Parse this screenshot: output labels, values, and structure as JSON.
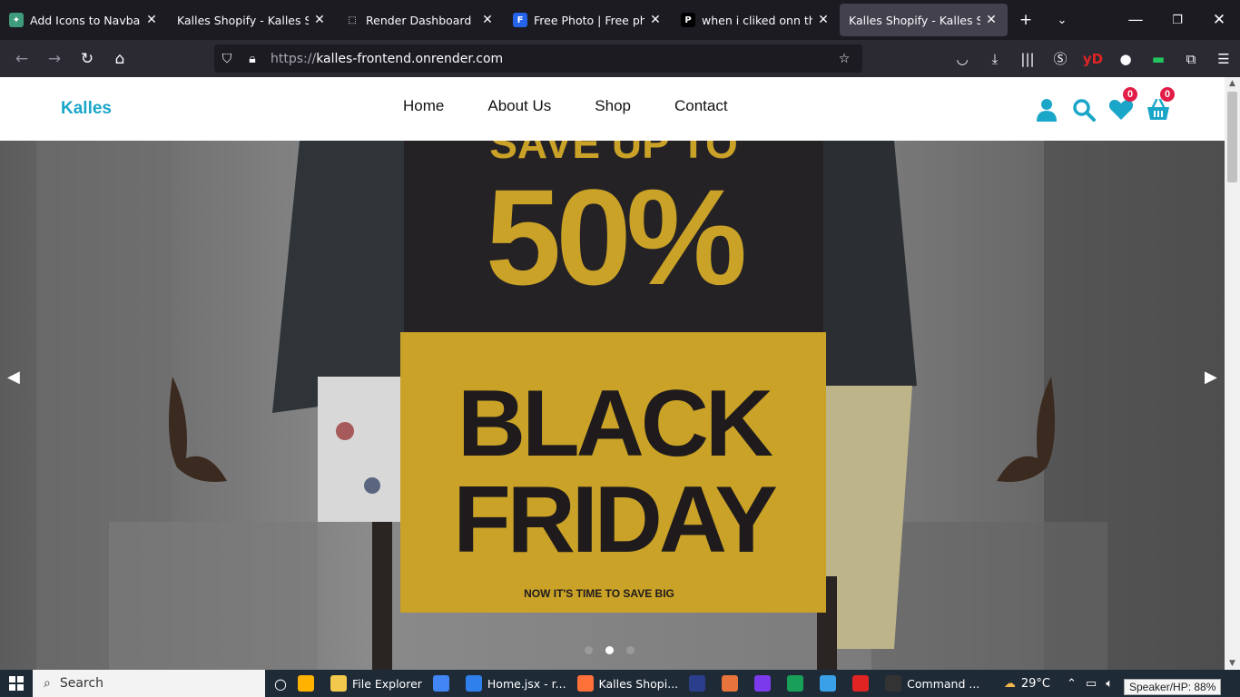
{
  "tabs": [
    {
      "title": "Add Icons to Navbar",
      "fav_color": "#3e9c7d",
      "fav_glyph": "✦",
      "active": false
    },
    {
      "title": "Kalles Shopify - Kalles Shopify",
      "fav_color": "",
      "fav_glyph": "",
      "active": false
    },
    {
      "title": "Render Dashboard",
      "fav_color": "#1c1b22",
      "fav_glyph": "⬚",
      "active": false
    },
    {
      "title": "Free Photo | Free photo",
      "fav_color": "#2563eb",
      "fav_glyph": "F",
      "active": false
    },
    {
      "title": "when i cliked onn the e",
      "fav_color": "#000000",
      "fav_glyph": "P",
      "active": false
    },
    {
      "title": "Kalles Shopify - Kalles Shopify",
      "fav_color": "",
      "fav_glyph": "",
      "active": true
    }
  ],
  "url": {
    "prefix": "https://",
    "host": "kalles-frontend.onrender.com"
  },
  "site": {
    "logo": "Kalles",
    "menu": [
      "Home",
      "About Us",
      "Shop",
      "Contact"
    ],
    "wishlist_count": "0",
    "cart_count": "0",
    "accent": "#1aa6c8"
  },
  "hero": {
    "line1": "SAVE UP TO",
    "percent": "50%",
    "line2": "BLACK",
    "line3": "FRIDAY",
    "tagline": "NOW IT'S TIME TO SAVE BIG",
    "active_slide": 1,
    "slide_count": 3
  },
  "taskbar": {
    "search": "Search",
    "apps": [
      {
        "label": "",
        "color": "#ffb300"
      },
      {
        "label": "File Explorer",
        "color": "#f2c94c"
      },
      {
        "label": "",
        "color": "#4285f4"
      },
      {
        "label": "Home.jsx - r...",
        "color": "#2f80ed"
      },
      {
        "label": "Kalles Shopi...",
        "color": "#ff7139"
      },
      {
        "label": "",
        "color": "#2b3e8c"
      },
      {
        "label": "",
        "color": "#e8743b"
      },
      {
        "label": "",
        "color": "#7c3aed"
      },
      {
        "label": "",
        "color": "#18a058"
      },
      {
        "label": "",
        "color": "#3aa0e8"
      },
      {
        "label": "",
        "color": "#e02424"
      },
      {
        "label": "Command ...",
        "color": "#333"
      }
    ],
    "temp": "29°C",
    "tooltip": "Speaker/HP: 88%"
  }
}
